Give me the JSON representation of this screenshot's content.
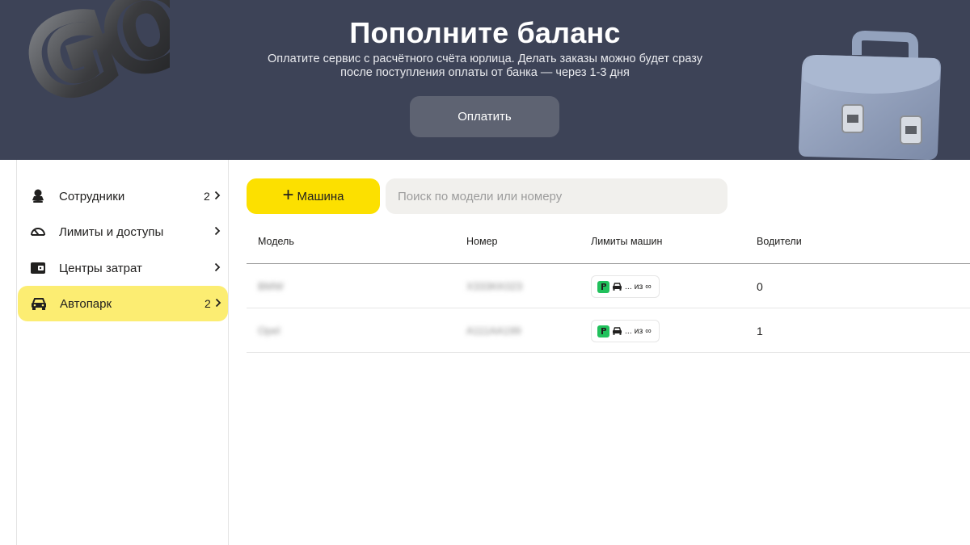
{
  "banner": {
    "title": "Пополните баланс",
    "subtitle_line1": "Оплатите сервис с расчётного счёта юрлица. Делать заказы можно будет сразу",
    "subtitle_line2": "после поступления оплаты от банка — через 1-3 дня",
    "pay_label": "Оплатить",
    "art_go_text": "GO",
    "art_icon": "briefcase-icon"
  },
  "sidebar": {
    "items": [
      {
        "label": "Сотрудники",
        "count": "2",
        "icon": "person-icon",
        "active": false
      },
      {
        "label": "Лимиты и доступы",
        "count": "",
        "icon": "speedometer-icon",
        "active": false
      },
      {
        "label": "Центры затрат",
        "count": "",
        "icon": "wallet-icon",
        "active": false
      },
      {
        "label": "Автопарк",
        "count": "2",
        "icon": "car-icon",
        "active": true
      }
    ]
  },
  "toolbar": {
    "add_plus": "+",
    "add_label": "Машина",
    "search_placeholder": "Поиск по модели или номеру"
  },
  "table": {
    "columns": [
      "Модель",
      "Номер",
      "Лимиты машин",
      "Водители"
    ],
    "rows": [
      {
        "model": "BMW",
        "number": "X333KK023",
        "limit_text": "... из ∞",
        "drivers": "0"
      },
      {
        "model": "Opel",
        "number": "A111AA199",
        "limit_text": "... из ∞",
        "drivers": "1"
      }
    ]
  },
  "colors": {
    "banner_bg": "#3d4357",
    "accent_yellow": "#fce000",
    "active_nav": "#fced72",
    "fuel_green": "#21c15c"
  }
}
